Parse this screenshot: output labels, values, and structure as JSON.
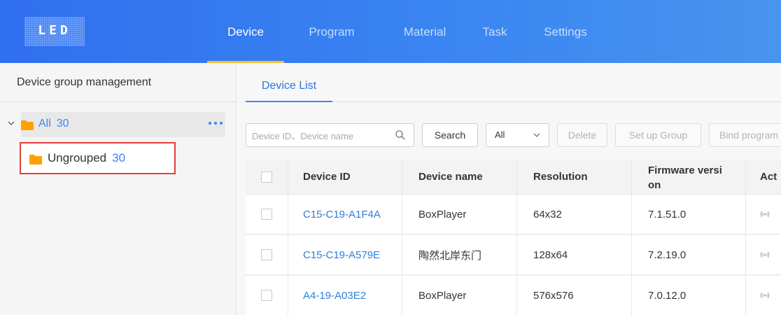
{
  "app": {
    "logo_text": "LED"
  },
  "nav": {
    "items": [
      {
        "label": "Device",
        "active": true
      },
      {
        "label": "Program",
        "active": false
      },
      {
        "label": "Material",
        "active": false
      },
      {
        "label": "Task",
        "active": false
      },
      {
        "label": "Settings",
        "active": false
      }
    ]
  },
  "sidebar": {
    "title": "Device group management",
    "tree": {
      "all": {
        "label": "All",
        "count": "30"
      },
      "ungrouped": {
        "label": "Ungrouped",
        "count": "30"
      }
    }
  },
  "main": {
    "tab": "Device List",
    "toolbar": {
      "search_placeholder": "Device ID、Device name",
      "search_button": "Search",
      "filter_value": "All",
      "delete_button": "Delete",
      "setup_group_button": "Set up Group",
      "bind_program_button": "Bind program li"
    },
    "table": {
      "columns": {
        "device_id": "Device ID",
        "device_name": "Device name",
        "resolution": "Resolution",
        "firmware_line1": "Firmware versi",
        "firmware_line2": "on",
        "action": "Act"
      },
      "rows": [
        {
          "device_id": "C15-C19-A1F4A",
          "device_name": "BoxPlayer",
          "resolution": "64x32",
          "firmware": "7.1.51.0"
        },
        {
          "device_id": "C15-C19-A579E",
          "device_name": "陶然北岸东门",
          "resolution": "128x64",
          "firmware": "7.2.19.0"
        },
        {
          "device_id": "A4-19-A03E2",
          "device_name": "BoxPlayer",
          "resolution": "576x576",
          "firmware": "7.0.12.0"
        }
      ]
    }
  },
  "colors": {
    "header_blue": "#3b86f1",
    "nav_active_underline": "#f5c02a",
    "folder_orange": "#ffa000",
    "link_blue": "#2e7fd9",
    "highlight_red": "#e0403a"
  },
  "icons": {
    "caret": "chevron-down-icon",
    "folder": "folder-icon",
    "more": "more-dots-icon",
    "search": "search-icon",
    "dropdown": "chevron-down-icon",
    "action": "signal-icon"
  }
}
